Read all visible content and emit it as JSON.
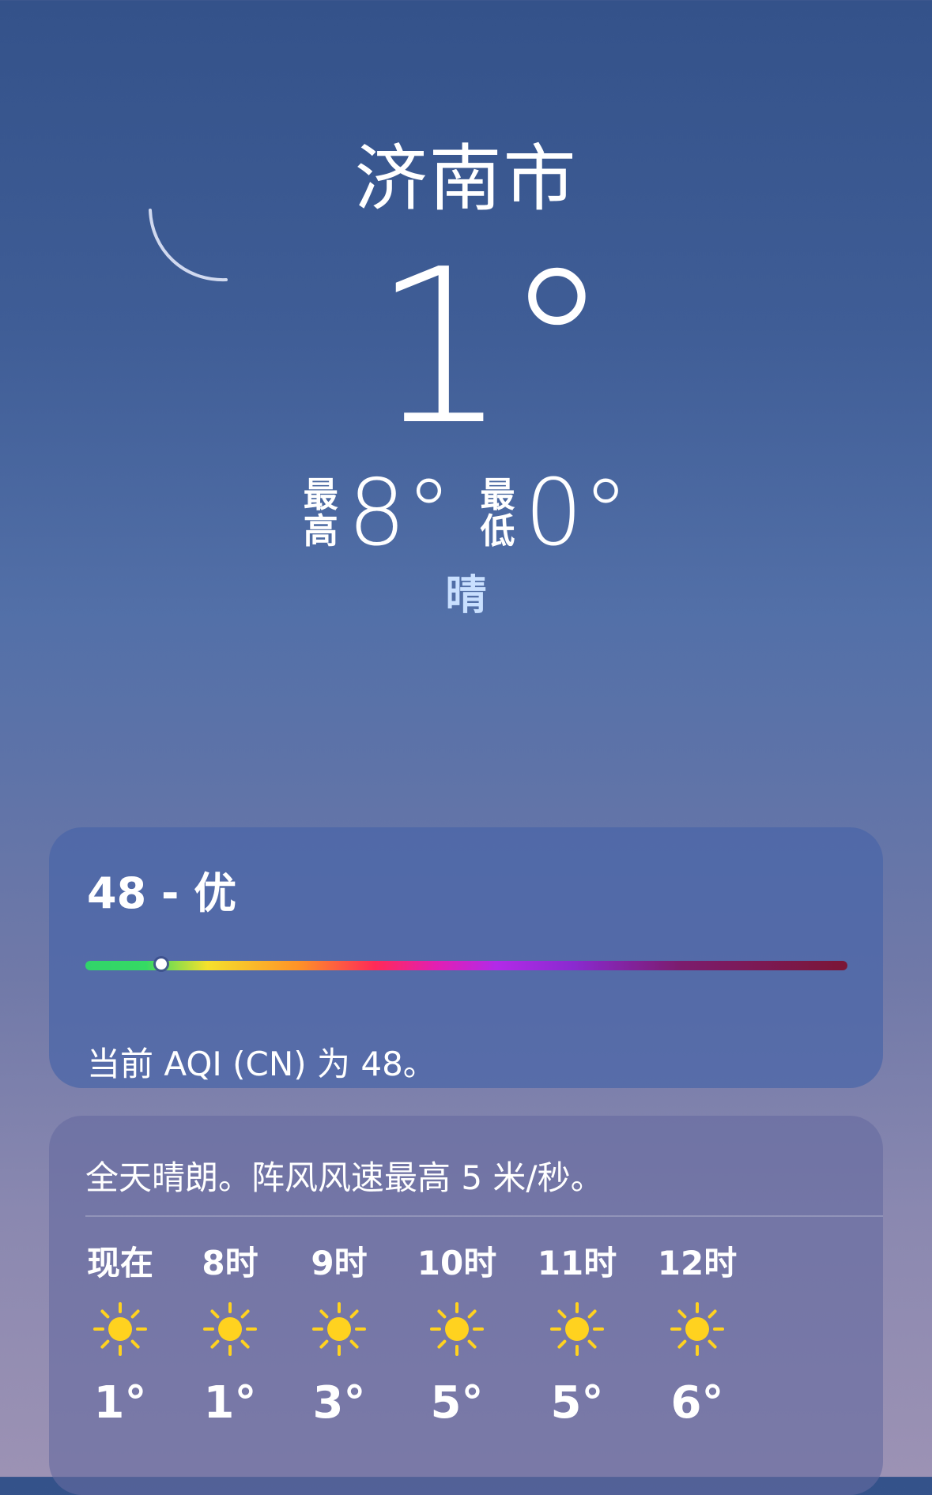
{
  "header": {
    "city": "济南市",
    "current_temp": "1°",
    "high_label_line1": "最",
    "high_label_line2": "高",
    "high_value": "8°",
    "low_label_line1": "最",
    "low_label_line2": "低",
    "low_value": "0°",
    "condition": "晴"
  },
  "icons": {
    "moon": "crescent-moon-icon",
    "sun": "sun-icon"
  },
  "colors": {
    "sun": "#ffd21f",
    "condition_text": "#c9e0ff"
  },
  "aqi": {
    "title": "48 - 优",
    "description": "当前 AQI (CN) 为 48。",
    "value": 48,
    "indicator_fraction": 0.1
  },
  "forecast": {
    "summary": "全天晴朗。阵风风速最高 5 米/秒。",
    "hours": [
      {
        "label": "现在",
        "temp": "1°",
        "icon": "sun-icon"
      },
      {
        "label": "8时",
        "temp": "1°",
        "icon": "sun-icon"
      },
      {
        "label": "9时",
        "temp": "3°",
        "icon": "sun-icon"
      },
      {
        "label": "10时",
        "temp": "5°",
        "icon": "sun-icon"
      },
      {
        "label": "11时",
        "temp": "5°",
        "icon": "sun-icon"
      },
      {
        "label": "12时",
        "temp": "6°",
        "icon": "sun-icon"
      }
    ]
  }
}
